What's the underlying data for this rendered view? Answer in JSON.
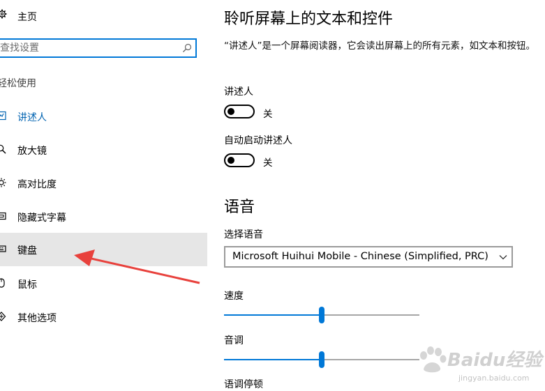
{
  "sidebar": {
    "home_label": "主页",
    "search": {
      "placeholder": "查找设置",
      "value": ""
    },
    "section_title": "轻松使用",
    "items": [
      {
        "label": "讲述人",
        "icon": "narrator-icon",
        "state": "active"
      },
      {
        "label": "放大镜",
        "icon": "magnifier-icon"
      },
      {
        "label": "高对比度",
        "icon": "high-contrast-icon"
      },
      {
        "label": "隐藏式字幕",
        "icon": "closed-captions-icon"
      },
      {
        "label": "键盘",
        "icon": "keyboard-icon",
        "state": "hover"
      },
      {
        "label": "鼠标",
        "icon": "mouse-icon"
      },
      {
        "label": "其他选项",
        "icon": "other-options-icon"
      }
    ]
  },
  "main": {
    "title": "聆听屏幕上的文本和控件",
    "description": "“讲述人”是一个屏幕阅读器，它会读出屏幕上的所有元素，如文本和按钮。",
    "narrator": {
      "label": "讲述人",
      "state": "关",
      "on": false
    },
    "autostart": {
      "label": "自动启动讲述人",
      "state": "关",
      "on": false
    },
    "voice_section": "语音",
    "choose_voice": {
      "label": "选择语音",
      "selected": "Microsoft Huihui Mobile - Chinese (Simplified, PRC)"
    },
    "speed": {
      "label": "速度",
      "level": 0.5
    },
    "pitch": {
      "label": "音调",
      "level": 0.5
    },
    "pause_label": "语调停顿"
  },
  "watermark": {
    "brand": "Baidu经验",
    "site": "jingyan.baidu.com"
  },
  "colors": {
    "accent": "#0078d7",
    "hover_bg": "#e6e6e6",
    "annotation_arrow": "#e8413c"
  }
}
